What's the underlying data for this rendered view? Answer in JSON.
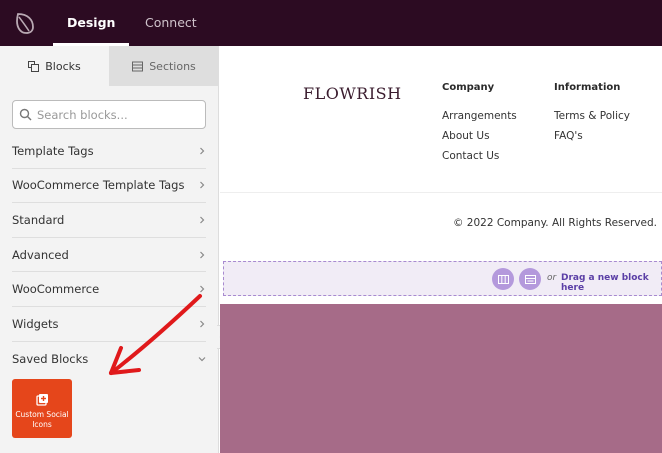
{
  "topbar": {
    "tabs": [
      {
        "label": "Design",
        "active": true
      },
      {
        "label": "Connect",
        "active": false
      }
    ],
    "background": "#2c0b22"
  },
  "sidebar": {
    "tabs": [
      {
        "label": "Blocks",
        "icon": "blocks-icon",
        "active": true
      },
      {
        "label": "Sections",
        "icon": "sections-icon",
        "active": false
      }
    ],
    "search": {
      "placeholder": "Search blocks...",
      "value": ""
    },
    "categories": [
      {
        "label": "Template Tags",
        "expanded": false
      },
      {
        "label": "WooCommerce Template Tags",
        "expanded": false
      },
      {
        "label": "Standard",
        "expanded": false
      },
      {
        "label": "Advanced",
        "expanded": false
      },
      {
        "label": "WooCommerce",
        "expanded": false
      },
      {
        "label": "Widgets",
        "expanded": false
      },
      {
        "label": "Saved Blocks",
        "expanded": true
      }
    ],
    "saved_block": {
      "label": "Custom Social Icons",
      "icon": "add-block-icon",
      "color": "#e5461b"
    }
  },
  "canvas": {
    "footer": {
      "brand": "FLOWRISH",
      "columns": [
        {
          "heading": "Company",
          "links": [
            "Arrangements",
            "About Us",
            "Contact Us"
          ]
        },
        {
          "heading": "Information",
          "links": [
            "Terms & Policy",
            "FAQ's"
          ]
        }
      ],
      "copyright": "© 2022 Company. All Rights Reserved."
    },
    "drop_zone": {
      "or_text": "or",
      "drag_text": "Drag a new block here",
      "accent": "#5b3fa6"
    },
    "section_color": "#a66b88"
  },
  "annotation": {
    "arrow_color": "#e0191b"
  }
}
